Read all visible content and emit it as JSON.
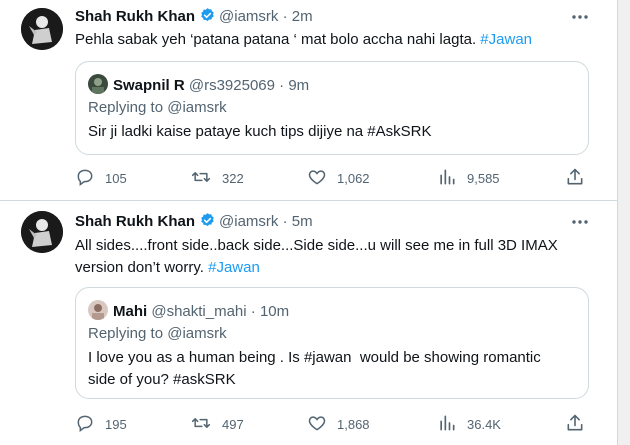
{
  "tweets": [
    {
      "author_name": "Shah Rukh Khan",
      "handle": "@iamsrk",
      "separator": "·",
      "time": "2m",
      "text_before": "Pehla sabak yeh ‘patana patana ‘ mat bolo accha nahi lagta. ",
      "hashtag": "#Jawan",
      "text_after": "",
      "quote": {
        "author_name": "Swapnil R",
        "handle": "@rs3925069",
        "separator": "·",
        "time": "9m",
        "replying_label": "Replying to ",
        "replying_to": "@iamsrk",
        "text": "Sir ji ladki kaise pataye kuch tips dijiye na #AskSRK"
      },
      "actions": {
        "replies": "105",
        "retweets": "322",
        "likes": "1,062",
        "views": "9,585"
      }
    },
    {
      "author_name": "Shah Rukh Khan",
      "handle": "@iamsrk",
      "separator": "·",
      "time": "5m",
      "text_line1": "All sides....front side..back side...Side side...u will see me in full 3D IMAX",
      "text_line2_before": "version don’t worry. ",
      "hashtag": "#Jawan",
      "quote": {
        "author_name": "Mahi",
        "handle": "@shakti_mahi",
        "separator": "·",
        "time": "10m",
        "replying_label": "Replying to ",
        "replying_to": "@iamsrk",
        "text_line1": "I love you as a human being . Is #jawan  would be showing romantic",
        "text_line2": "side of you? #askSRK"
      },
      "actions": {
        "replies": "195",
        "retweets": "497",
        "likes": "1,868",
        "views": "36.4K"
      }
    }
  ],
  "icons": {
    "verified": "verified-badge-icon",
    "more": "more-horizontal-icon",
    "reply": "reply-icon",
    "retweet": "retweet-icon",
    "like": "like-icon",
    "views": "views-icon",
    "share": "share-icon"
  },
  "colors": {
    "accent": "#1d9bf0",
    "text": "#0f1419",
    "muted": "#536471",
    "border": "#cfd9de"
  }
}
